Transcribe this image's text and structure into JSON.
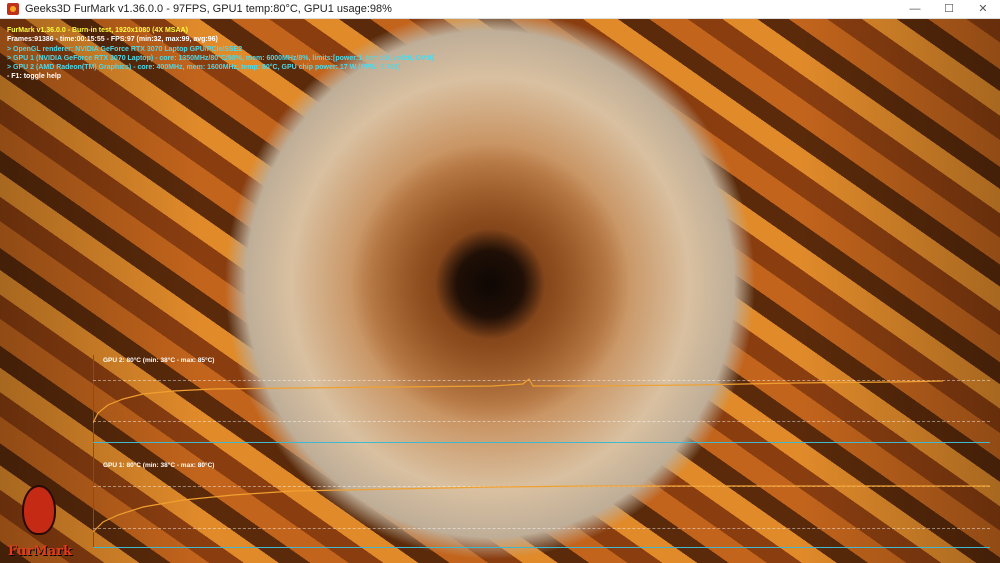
{
  "window": {
    "title": "Geeks3D FurMark v1.36.0.0 - 97FPS, GPU1 temp:80°C, GPU1 usage:98%",
    "minimize": "—",
    "maximize": "☐",
    "close": "✕"
  },
  "hud": {
    "line0": "FurMark v1.36.0.0 - Burn-in test, 1920x1080 (4X MSAA)",
    "line1": "Frames:91386 - time:00:15:55 - FPS:97 (min:32, max:99, avg:96)",
    "line2": "> OpenGL renderer: NVIDIA GeForce RTX 3070 Laptop GPU/PCIe/SSE2",
    "line3": "> GPU 1 (NVIDIA GeForce RTX 3070 Laptop) - core: 1350MHz/80°C/98%, mem: 6000MHz/8%, limits:[power:1, temp:0, volt:0, OV:0]",
    "line4": "> GPU 2 (AMD Radeon(TM) Graphics) - core: 400MHz, mem: 1600MHz, temp: 80°C, GPU chip power: 17 W (PPW: 5.706)",
    "line5": "- F1: toggle help"
  },
  "graphs": [
    {
      "label": "GPU 2: 80°C (min: 38°C - max: 85°C)",
      "color": "#f0a030"
    },
    {
      "label": "GPU 1: 80°C (min: 38°C - max: 80°C)",
      "color": "#f0a030"
    }
  ],
  "logo": {
    "text": "FurMark"
  }
}
